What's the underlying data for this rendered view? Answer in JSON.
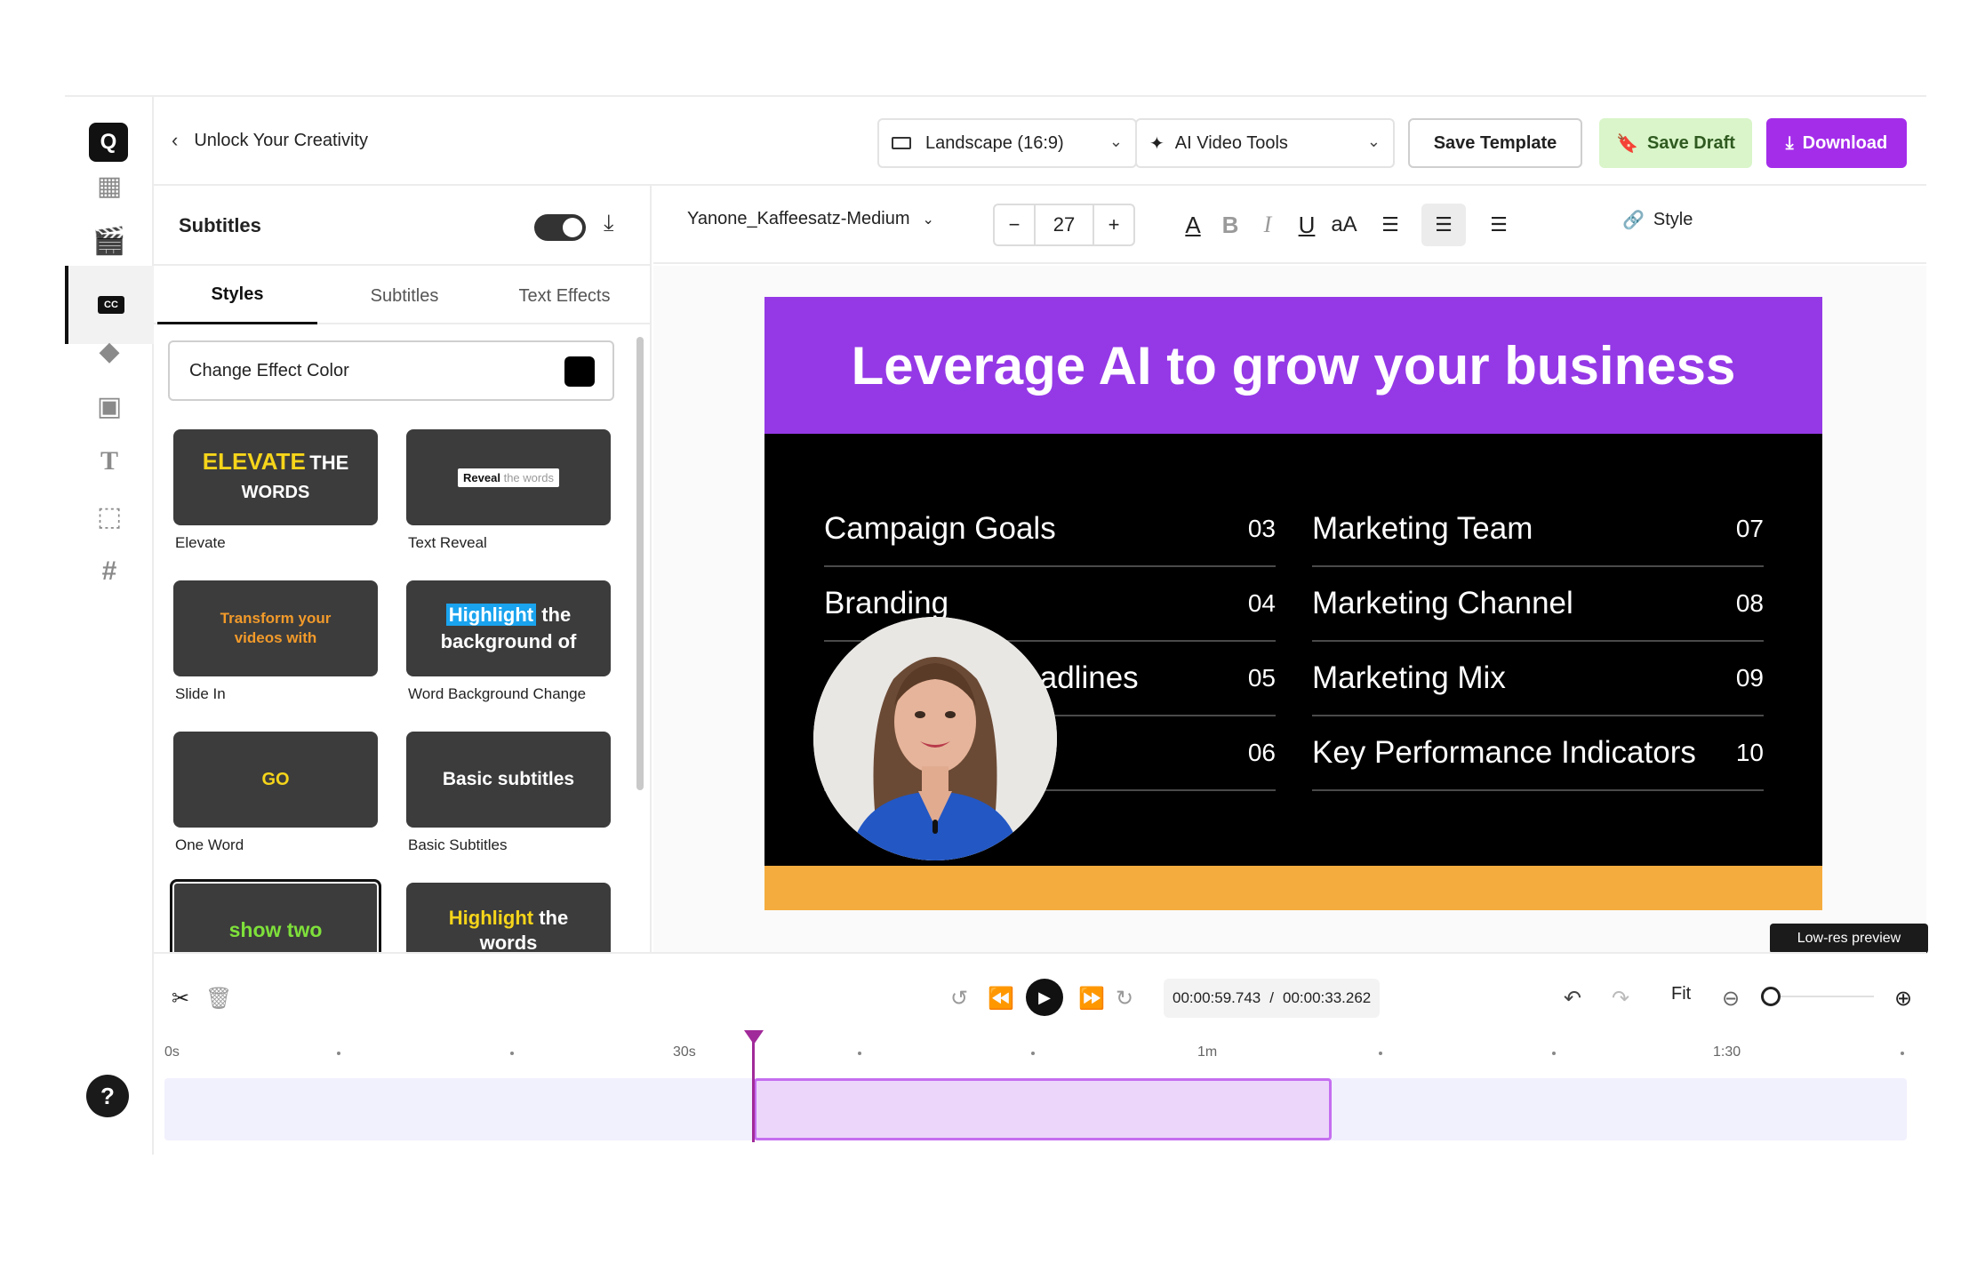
{
  "header": {
    "back_label": "Unlock Your Creativity",
    "format_select": "Landscape (16:9)",
    "ai_tools_select": "AI Video Tools",
    "save_template": "Save Template",
    "save_draft": "Save Draft",
    "download": "Download"
  },
  "panel": {
    "title": "Subtitles",
    "tabs": [
      "Styles",
      "Subtitles",
      "Text Effects"
    ],
    "active_tab": "Styles",
    "effect_color_label": "Change Effect Color",
    "effect_color": "#000000",
    "styles": [
      {
        "label": "Elevate",
        "preview_a": "ELEVATE",
        "preview_b": "THE",
        "preview_c": "WORDS"
      },
      {
        "label": "Text Reveal",
        "preview_a": "Reveal",
        "preview_b": "the words"
      },
      {
        "label": "Slide In",
        "preview_a": "Transform your",
        "preview_b": "videos with"
      },
      {
        "label": "Word Background Change",
        "preview_a": "Highlight",
        "preview_b": "the",
        "preview_c": "background of"
      },
      {
        "label": "One Word",
        "preview_a": "GO"
      },
      {
        "label": "Basic Subtitles",
        "preview_a": "Basic subtitles"
      },
      {
        "label": "",
        "preview_a": "show two"
      },
      {
        "label": "",
        "preview_a": "Highlight",
        "preview_b": "the",
        "preview_c": "words"
      }
    ]
  },
  "toolbar": {
    "font": "Yanone_Kaffeesatz-Medium",
    "font_size": "27",
    "case_label": "aA",
    "style_label": "Style"
  },
  "slide": {
    "title": "Leverage AI to grow your business",
    "left_items": [
      {
        "text": "Campaign Goals",
        "num": "03"
      },
      {
        "text": "Branding",
        "num": "04"
      },
      {
        "text": "Headlines",
        "num": "05"
      },
      {
        "text": "",
        "num": "06"
      }
    ],
    "right_items": [
      {
        "text": "Marketing Team",
        "num": "07"
      },
      {
        "text": "Marketing Channel",
        "num": "08"
      },
      {
        "text": "Marketing Mix",
        "num": "09"
      },
      {
        "text": "Key Performance Indicators",
        "num": "10"
      }
    ],
    "colors": {
      "header": "#9539e6",
      "footer": "#f5ac3e",
      "body": "#000000"
    }
  },
  "preview_badge": "Low-res preview",
  "timeline": {
    "current_time": "00:00:59.743",
    "separator": "/",
    "total_time": "00:00:33.262",
    "fit_label": "Fit",
    "ruler": [
      "0s",
      "30s",
      "1m",
      "1:30"
    ]
  },
  "rail": {
    "logo": "Q",
    "help": "?",
    "items": [
      "layout-icon",
      "clapper-icon",
      "captions-icon",
      "shapes-icon",
      "image-icon",
      "text-icon",
      "resize-icon",
      "hashtag-icon"
    ]
  }
}
